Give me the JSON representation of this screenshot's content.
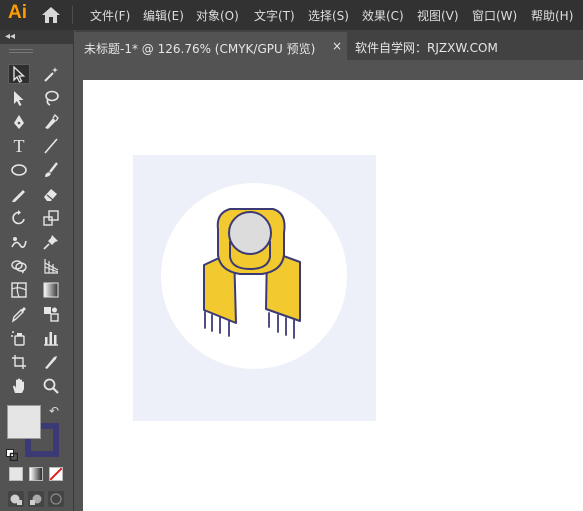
{
  "app": {
    "logo": "Ai"
  },
  "menu": {
    "items": [
      "文件(F)",
      "编辑(E)",
      "对象(O)",
      "文字(T)",
      "选择(S)",
      "效果(C)",
      "视图(V)",
      "窗口(W)",
      "帮助(H)"
    ]
  },
  "tabs": {
    "active_title": "未标题-1* @ 126.76% (CMYK/GPU 预览)",
    "close_glyph": "×",
    "second_title": "软件自学网：RJZXW.COM"
  },
  "colors": {
    "brand": "#ff9a00",
    "artboard_bg": "#eef0f9",
    "scarf_fill": "#f2c92e",
    "outline": "#3c3a74",
    "head_fill": "#dcdcdc",
    "fill_swatch": "#e5e5e5"
  },
  "toolbar": {
    "collapse_glyph": "◂◂",
    "type_tool_glyph": "T",
    "swap_glyph": "↶"
  }
}
